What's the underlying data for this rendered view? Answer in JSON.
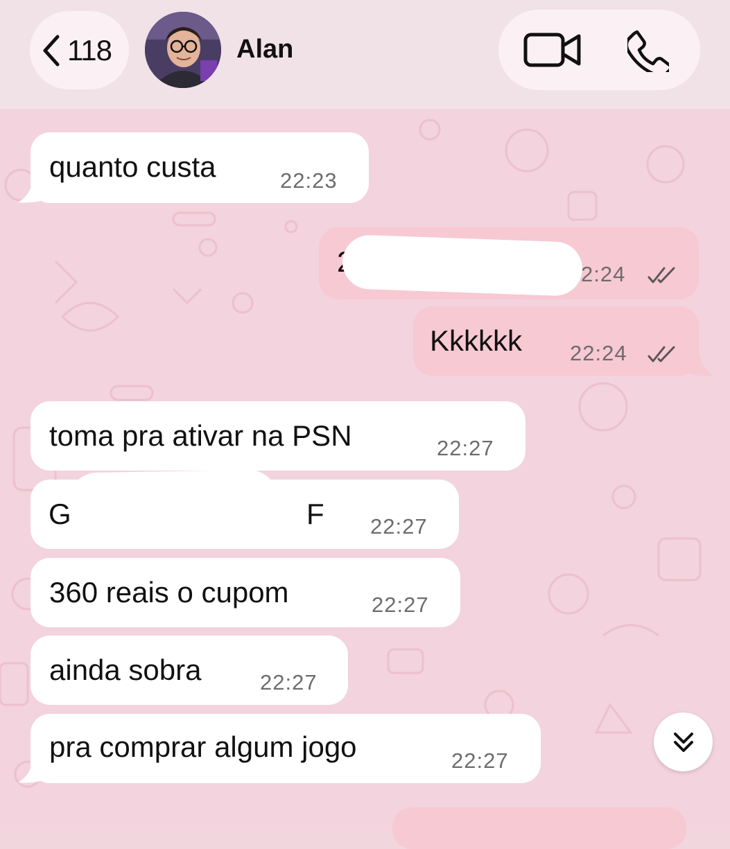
{
  "header": {
    "back_count": "118",
    "contact_name": "Alan"
  },
  "messages": [
    {
      "direction": "in",
      "text": "quanto custa",
      "time": "22:23"
    },
    {
      "direction": "out",
      "text": "2",
      "time": "2:24",
      "redacted": true
    },
    {
      "direction": "out",
      "text": "Kkkkkk",
      "time": "22:24"
    },
    {
      "direction": "in",
      "text": "toma pra ativar na PSN",
      "time": "22:27"
    },
    {
      "direction": "in",
      "text": "G",
      "text_end": "F",
      "time": "22:27",
      "redacted": true
    },
    {
      "direction": "in",
      "text": "360 reais o cupom",
      "time": "22:27"
    },
    {
      "direction": "in",
      "text": "ainda sobra",
      "time": "22:27"
    },
    {
      "direction": "in",
      "text": "pra comprar algum jogo",
      "time": "22:27"
    }
  ],
  "colors": {
    "incoming_bubble": "#ffffff",
    "outgoing_bubble": "#f7c9d3",
    "chat_background": "#f3d3dd",
    "header_background": "#f1e2e7"
  },
  "icons": [
    "chevron-left-icon",
    "video-camera-icon",
    "phone-icon",
    "double-check-icon",
    "double-chevron-down-icon"
  ]
}
